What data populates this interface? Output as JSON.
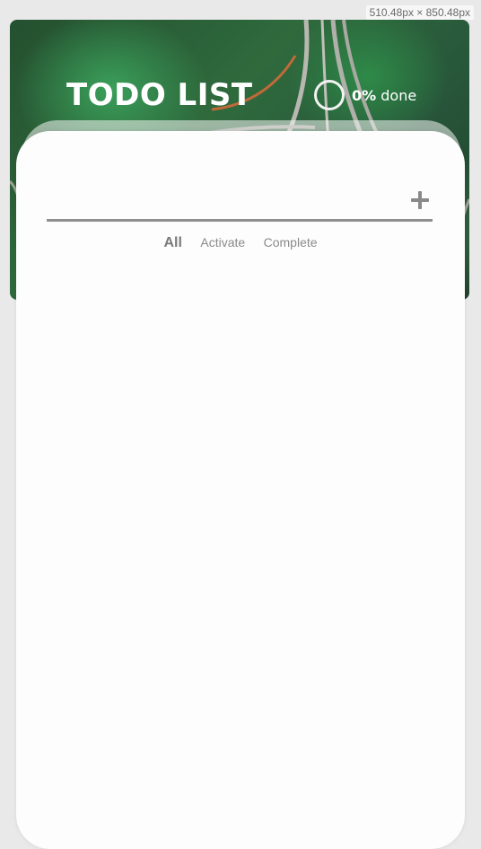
{
  "viewport_readout": "510.48px × 850.48px",
  "header": {
    "title": "TODO LIST",
    "progress_percent": "0%",
    "progress_suffix": " done",
    "progress_value": 0
  },
  "todo_input": {
    "value": "",
    "placeholder": ""
  },
  "add_button_icon": "plus-icon",
  "filters": [
    {
      "label": "All",
      "active": true
    },
    {
      "label": "Activate",
      "active": false
    },
    {
      "label": "Complete",
      "active": false
    }
  ],
  "colors": {
    "card": "#fdfdfd",
    "accent_gray": "#8a8a8a",
    "header_text": "#ffffff"
  }
}
